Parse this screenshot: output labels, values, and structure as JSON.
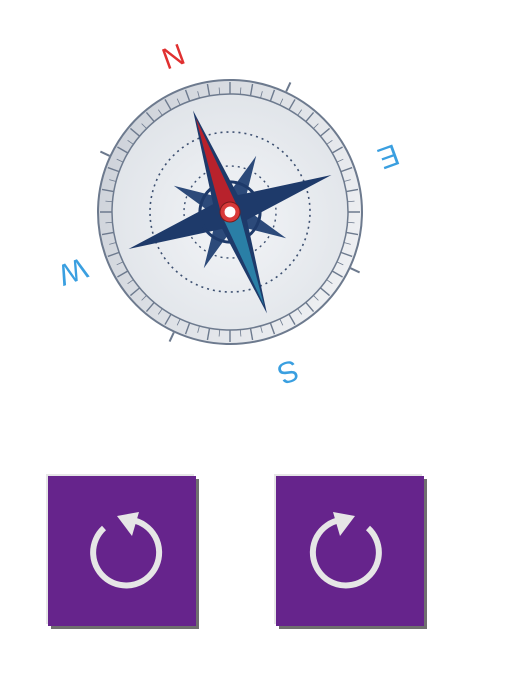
{
  "compass": {
    "heading_deg": 160,
    "directions": {
      "north": "N",
      "south": "S",
      "east": "E",
      "west": "W"
    },
    "colors": {
      "north_needle": "#b8222c",
      "south_needle": "#2a7fa6",
      "north_label": "#e03030",
      "other_labels": "#3a9fe0",
      "star_points": "#1e3a6a",
      "face": "#e9ecf0"
    }
  },
  "controls": {
    "rotate_left": {
      "icon": "rotate-counterclockwise-icon"
    },
    "rotate_right": {
      "icon": "rotate-clockwise-icon"
    },
    "button_color": "#66248c",
    "icon_color": "#e6e6e6"
  }
}
